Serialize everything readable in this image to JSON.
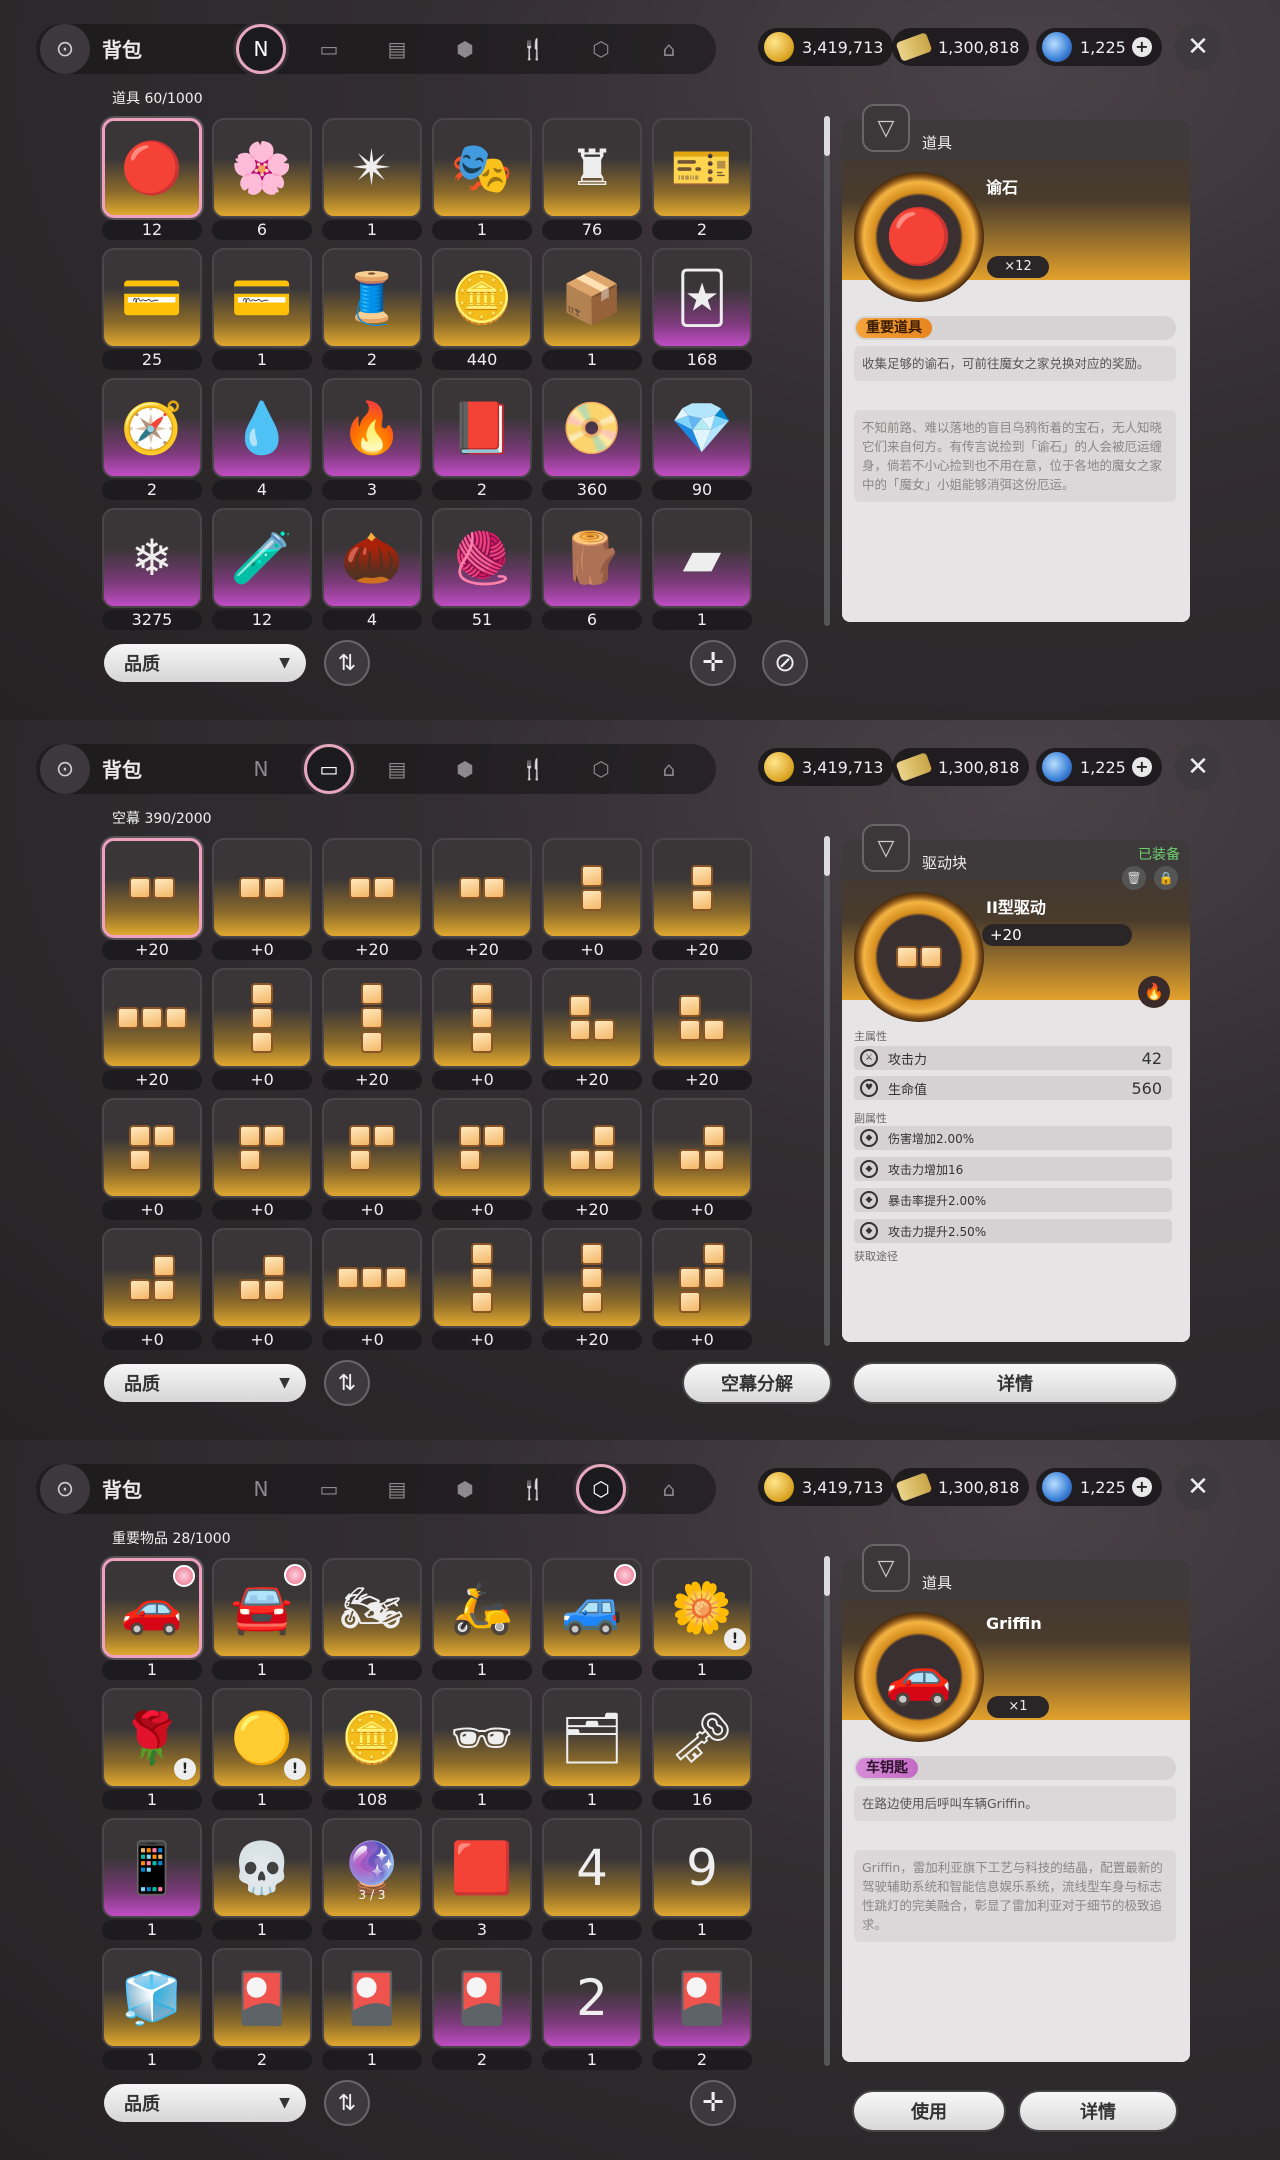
{
  "currency": {
    "gold": "3,419,713",
    "ticket": "1,300,818",
    "gem": "1,225"
  },
  "title": "背包",
  "panels": [
    {
      "grid_label": "道具  60/1000",
      "items": [
        {
          "icon": "🔴",
          "count": "12",
          "rarity": "gold"
        },
        {
          "icon": "🌸",
          "count": "6",
          "rarity": "gold"
        },
        {
          "icon": "✴",
          "count": "1",
          "rarity": "gold"
        },
        {
          "icon": "🎭",
          "count": "1",
          "rarity": "gold"
        },
        {
          "icon": "♜",
          "count": "76",
          "rarity": "gold"
        },
        {
          "icon": "🎫",
          "count": "2",
          "rarity": "gold"
        },
        {
          "icon": "💳",
          "count": "25",
          "rarity": "gold"
        },
        {
          "icon": "💳",
          "count": "1",
          "rarity": "gold"
        },
        {
          "icon": "🧵",
          "count": "2",
          "rarity": "gold"
        },
        {
          "icon": "🪙",
          "count": "440",
          "rarity": "gold"
        },
        {
          "icon": "📦",
          "count": "1",
          "rarity": "gold"
        },
        {
          "icon": "🃏",
          "count": "168",
          "rarity": "purple"
        },
        {
          "icon": "🧭",
          "count": "2",
          "rarity": "purple"
        },
        {
          "icon": "💧",
          "count": "4",
          "rarity": "purple"
        },
        {
          "icon": "🔥",
          "count": "3",
          "rarity": "purple"
        },
        {
          "icon": "📕",
          "count": "2",
          "rarity": "purple"
        },
        {
          "icon": "📀",
          "count": "360",
          "rarity": "purple"
        },
        {
          "icon": "💎",
          "count": "90",
          "rarity": "purple"
        },
        {
          "icon": "❄",
          "count": "3275",
          "rarity": "purple"
        },
        {
          "icon": "🧪",
          "count": "12",
          "rarity": "purple"
        },
        {
          "icon": "🌰",
          "count": "4",
          "rarity": "purple"
        },
        {
          "icon": "🧶",
          "count": "51",
          "rarity": "purple"
        },
        {
          "icon": "🪵",
          "count": "6",
          "rarity": "purple"
        },
        {
          "icon": "▰",
          "count": "1",
          "rarity": "purple"
        }
      ],
      "filter_label": "品质",
      "detail": {
        "header": "道具",
        "name": "谕石",
        "qty": "×12",
        "tag": "重要道具",
        "desc1": "收集足够的谕石，可前往魔女之家兑换对应的奖励。",
        "desc2": "不知前路、难以落地的盲目乌鸦衔着的宝石，无人知晓它们来自何方。有传言说捡到「谕石」的人会被厄运缠身，倘若不小心捡到也不用在意，位于各地的魔女之家中的「魔女」小姐能够消弭这份厄运。"
      }
    },
    {
      "grid_label": "空幕  390/2000",
      "items": [
        {
          "shape": "h2",
          "count": "+20"
        },
        {
          "shape": "h2",
          "count": "+0"
        },
        {
          "shape": "h2",
          "count": "+20"
        },
        {
          "shape": "h2",
          "count": "+20"
        },
        {
          "shape": "v2",
          "count": "+0"
        },
        {
          "shape": "v2",
          "count": "+20"
        },
        {
          "shape": "h3",
          "count": "+20"
        },
        {
          "shape": "v3",
          "count": "+0"
        },
        {
          "shape": "v3",
          "count": "+20"
        },
        {
          "shape": "v3",
          "count": "+0"
        },
        {
          "shape": "L",
          "count": "+20"
        },
        {
          "shape": "L",
          "count": "+20"
        },
        {
          "shape": "P",
          "count": "+0"
        },
        {
          "shape": "P",
          "count": "+0"
        },
        {
          "shape": "P",
          "count": "+0"
        },
        {
          "shape": "P",
          "count": "+0"
        },
        {
          "shape": "J",
          "count": "+20"
        },
        {
          "shape": "J",
          "count": "+0"
        },
        {
          "shape": "J",
          "count": "+0"
        },
        {
          "shape": "J",
          "count": "+0"
        },
        {
          "shape": "h3",
          "count": "+0"
        },
        {
          "shape": "v3",
          "count": "+0"
        },
        {
          "shape": "v3",
          "count": "+20"
        },
        {
          "shape": "S",
          "count": "+0"
        }
      ],
      "filter_label": "品质",
      "decompose_label": "空幕分解",
      "details_label": "详情",
      "detail": {
        "header": "驱动块",
        "equipped": "已装备",
        "name": "II型驱动",
        "level": "+20",
        "main_label": "主属性",
        "main_stats": [
          {
            "name": "攻击力",
            "value": "42"
          },
          {
            "name": "生命值",
            "value": "560"
          }
        ],
        "sub_label": "副属性",
        "sub_stats": [
          {
            "name": "伤害增加2.00%"
          },
          {
            "name": "攻击力增加16"
          },
          {
            "name": "暴击率提升2.00%"
          },
          {
            "name": "攻击力提升2.50%"
          }
        ],
        "source_label": "获取途径"
      }
    },
    {
      "grid_label": "重要物品  28/1000",
      "items": [
        {
          "icon": "🚗",
          "count": "1",
          "rarity": "gold",
          "badge": true
        },
        {
          "icon": "🚘",
          "count": "1",
          "rarity": "gold",
          "badge": true
        },
        {
          "icon": "🏍",
          "count": "1",
          "rarity": "gold"
        },
        {
          "icon": "🛵",
          "count": "1",
          "rarity": "gold"
        },
        {
          "icon": "🚙",
          "count": "1",
          "rarity": "gold",
          "badge": true
        },
        {
          "icon": "🌼",
          "count": "1",
          "rarity": "gold",
          "warn": true
        },
        {
          "icon": "🌹",
          "count": "1",
          "rarity": "gold",
          "warn": true
        },
        {
          "icon": "🟡",
          "count": "1",
          "rarity": "gold",
          "warn": true
        },
        {
          "icon": "🪙",
          "count": "108",
          "rarity": "gold"
        },
        {
          "icon": "🕶",
          "count": "1",
          "rarity": "gold"
        },
        {
          "icon": "🗂",
          "count": "1",
          "rarity": "gold"
        },
        {
          "icon": "🗝",
          "count": "16",
          "rarity": "gold"
        },
        {
          "icon": "📱",
          "count": "1",
          "rarity": "purple"
        },
        {
          "icon": "💀",
          "count": "1",
          "rarity": "gold"
        },
        {
          "icon": "🔮",
          "count": "1",
          "rarity": "gold",
          "sub": "3 / 3"
        },
        {
          "icon": "🟥",
          "count": "3",
          "rarity": "gold"
        },
        {
          "icon": "4",
          "count": "1",
          "rarity": "gold"
        },
        {
          "icon": "9",
          "count": "1",
          "rarity": "gold"
        },
        {
          "icon": "🧊",
          "count": "1",
          "rarity": "gold"
        },
        {
          "icon": "🎴",
          "count": "2",
          "rarity": "gold"
        },
        {
          "icon": "🎴",
          "count": "1",
          "rarity": "gold"
        },
        {
          "icon": "🎴",
          "count": "2",
          "rarity": "purple"
        },
        {
          "icon": "2",
          "count": "1",
          "rarity": "purple"
        },
        {
          "icon": "🎴",
          "count": "2",
          "rarity": "purple"
        }
      ],
      "filter_label": "品质",
      "use_label": "使用",
      "details_label": "详情",
      "detail": {
        "header": "道具",
        "name": "Griffin",
        "qty": "×1",
        "tag": "车钥匙",
        "desc1": "在路边使用后呼叫车辆Griffin。",
        "desc2": "Griffin，雷加利亚旗下工艺与科技的结晶，配置最新的驾驶辅助系统和智能信息娱乐系统，流线型车身与标志性跳灯的完美融合，彰显了雷加利亚对于细节的极致追求。"
      }
    }
  ]
}
